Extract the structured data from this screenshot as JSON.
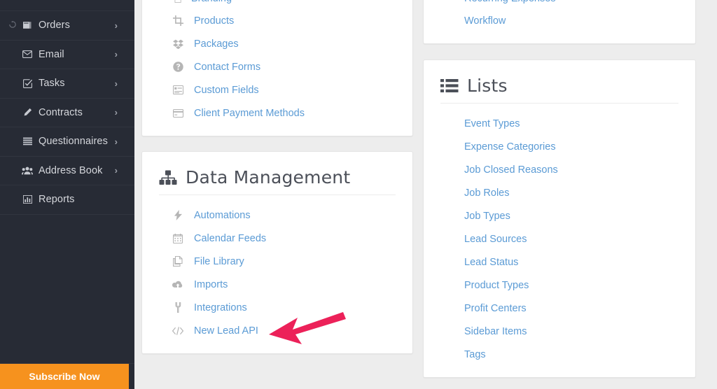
{
  "colors": {
    "sidebar_bg": "#272b35",
    "page_bg": "#ededed",
    "card_bg": "#ffffff",
    "link_blue": "#5b9bd5",
    "heading_gray": "#4c5059",
    "subscribe_orange": "#f6921e",
    "arrow_pink": "#ec2159"
  },
  "sidebar": {
    "partial_top_label": "",
    "items": [
      {
        "label": "Orders",
        "icon": "book-icon",
        "lead_icon": "sync-icon",
        "chevron": "›",
        "has_chevron": true
      },
      {
        "label": "Email",
        "icon": "envelope-icon",
        "lead_icon": "",
        "chevron": "›",
        "has_chevron": true
      },
      {
        "label": "Tasks",
        "icon": "check-square-icon",
        "lead_icon": "",
        "chevron": "›",
        "has_chevron": true
      },
      {
        "label": "Contracts",
        "icon": "pencil-icon",
        "lead_icon": "",
        "chevron": "›",
        "has_chevron": true
      },
      {
        "label": "Questionnaires",
        "icon": "list-icon",
        "lead_icon": "",
        "chevron": "›",
        "has_chevron": true
      },
      {
        "label": "Address Book",
        "icon": "users-icon",
        "lead_icon": "",
        "chevron": "›",
        "has_chevron": true
      },
      {
        "label": "Reports",
        "icon": "bar-chart-icon",
        "lead_icon": "",
        "chevron": "",
        "has_chevron": false
      }
    ],
    "subscribe_label": "Subscribe Now"
  },
  "middle_column": {
    "card_settings": {
      "partial_top_link": "Branding",
      "links": [
        {
          "label": "Products",
          "icon": "crop-icon"
        },
        {
          "label": "Packages",
          "icon": "dropbox-icon"
        },
        {
          "label": "Contact Forms",
          "icon": "question-circle-icon"
        },
        {
          "label": "Custom Fields",
          "icon": "list-alt-icon"
        },
        {
          "label": "Client Payment Methods",
          "icon": "credit-card-icon"
        }
      ]
    },
    "card_data_management": {
      "title": "Data Management",
      "title_icon": "sitemap-icon",
      "links": [
        {
          "label": "Automations",
          "icon": "bolt-icon"
        },
        {
          "label": "Calendar Feeds",
          "icon": "calendar-icon"
        },
        {
          "label": "File Library",
          "icon": "files-icon"
        },
        {
          "label": "Imports",
          "icon": "cloud-upload-icon"
        },
        {
          "label": "Integrations",
          "icon": "plug-icon"
        },
        {
          "label": "New Lead API",
          "icon": "code-icon"
        }
      ]
    }
  },
  "right_column": {
    "card_finances": {
      "partial_top_link": "Recurring Expenses",
      "links": [
        {
          "label": "Workflow"
        }
      ]
    },
    "card_lists": {
      "title": "Lists",
      "title_icon": "list-ul-icon",
      "links": [
        {
          "label": "Event Types"
        },
        {
          "label": "Expense Categories"
        },
        {
          "label": "Job Closed Reasons"
        },
        {
          "label": "Job Roles"
        },
        {
          "label": "Job Types"
        },
        {
          "label": "Lead Sources"
        },
        {
          "label": "Lead Status"
        },
        {
          "label": "Product Types"
        },
        {
          "label": "Profit Centers"
        },
        {
          "label": "Sidebar Items"
        },
        {
          "label": "Tags"
        }
      ]
    }
  },
  "annotation": {
    "arrow": {
      "name": "pointer-arrow",
      "points_to": "New Lead API",
      "color": "#ec2159"
    }
  }
}
